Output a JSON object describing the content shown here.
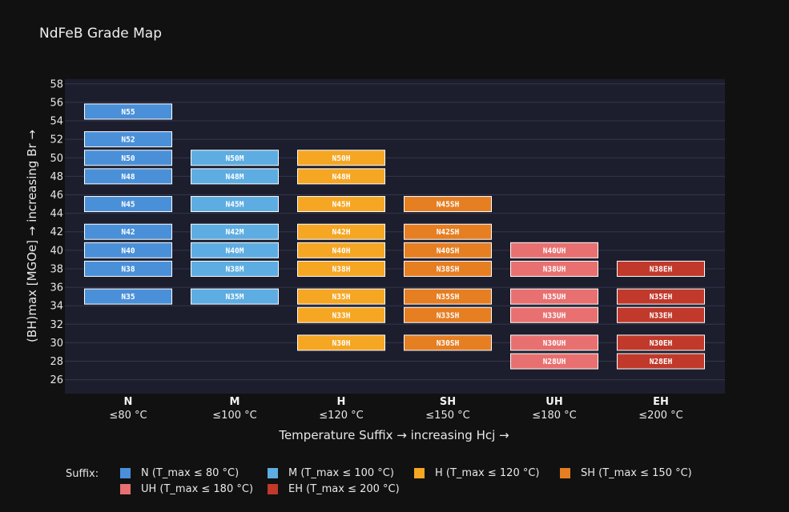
{
  "chart_data": {
    "type": "heatmap",
    "title": "NdFeB Grade Map",
    "xlabel": "Temperature Suffix  →  increasing Hcj  →",
    "ylabel": "(BH)max  [MGOe]  →  increasing Br  →",
    "ylim": [
      24.5,
      58.5
    ],
    "yticks": [
      26,
      28,
      30,
      32,
      34,
      36,
      38,
      40,
      42,
      44,
      46,
      48,
      50,
      52,
      54,
      56,
      58
    ],
    "grid": true,
    "categories": [
      {
        "code": "N",
        "temp": "≤80 °C"
      },
      {
        "code": "M",
        "temp": "≤100 °C"
      },
      {
        "code": "H",
        "temp": "≤120 °C"
      },
      {
        "code": "SH",
        "temp": "≤150 °C"
      },
      {
        "code": "UH",
        "temp": "≤180 °C"
      },
      {
        "code": "EH",
        "temp": "≤200 °C"
      }
    ],
    "series": [
      {
        "name": "N  (T_max ≤ 80 °C)",
        "color": "#4a90d9",
        "points": [
          {
            "value": 55,
            "label": "N55"
          },
          {
            "value": 52,
            "label": "N52"
          },
          {
            "value": 50,
            "label": "N50"
          },
          {
            "value": 48,
            "label": "N48"
          },
          {
            "value": 45,
            "label": "N45"
          },
          {
            "value": 42,
            "label": "N42"
          },
          {
            "value": 40,
            "label": "N40"
          },
          {
            "value": 38,
            "label": "N38"
          },
          {
            "value": 35,
            "label": "N35"
          }
        ]
      },
      {
        "name": "M  (T_max ≤ 100 °C)",
        "color": "#5dade2",
        "points": [
          {
            "value": 50,
            "label": "N50M"
          },
          {
            "value": 48,
            "label": "N48M"
          },
          {
            "value": 45,
            "label": "N45M"
          },
          {
            "value": 42,
            "label": "N42M"
          },
          {
            "value": 40,
            "label": "N40M"
          },
          {
            "value": 38,
            "label": "N38M"
          },
          {
            "value": 35,
            "label": "N35M"
          }
        ]
      },
      {
        "name": "H  (T_max ≤ 120 °C)",
        "color": "#f5a623",
        "points": [
          {
            "value": 50,
            "label": "N50H"
          },
          {
            "value": 48,
            "label": "N48H"
          },
          {
            "value": 45,
            "label": "N45H"
          },
          {
            "value": 42,
            "label": "N42H"
          },
          {
            "value": 40,
            "label": "N40H"
          },
          {
            "value": 38,
            "label": "N38H"
          },
          {
            "value": 35,
            "label": "N35H"
          },
          {
            "value": 33,
            "label": "N33H"
          },
          {
            "value": 30,
            "label": "N30H"
          }
        ]
      },
      {
        "name": "SH  (T_max ≤ 150 °C)",
        "color": "#e67e22",
        "points": [
          {
            "value": 45,
            "label": "N45SH"
          },
          {
            "value": 42,
            "label": "N42SH"
          },
          {
            "value": 40,
            "label": "N40SH"
          },
          {
            "value": 38,
            "label": "N38SH"
          },
          {
            "value": 35,
            "label": "N35SH"
          },
          {
            "value": 33,
            "label": "N33SH"
          },
          {
            "value": 30,
            "label": "N30SH"
          }
        ]
      },
      {
        "name": "UH  (T_max ≤ 180 °C)",
        "color": "#e87070",
        "points": [
          {
            "value": 40,
            "label": "N40UH"
          },
          {
            "value": 38,
            "label": "N38UH"
          },
          {
            "value": 35,
            "label": "N35UH"
          },
          {
            "value": 33,
            "label": "N33UH"
          },
          {
            "value": 30,
            "label": "N30UH"
          },
          {
            "value": 28,
            "label": "N28UH"
          }
        ]
      },
      {
        "name": "EH  (T_max ≤ 200 °C)",
        "color": "#c0392b",
        "points": [
          {
            "value": 38,
            "label": "N38EH"
          },
          {
            "value": 35,
            "label": "N35EH"
          },
          {
            "value": 33,
            "label": "N33EH"
          },
          {
            "value": 30,
            "label": "N30EH"
          },
          {
            "value": 28,
            "label": "N28EH"
          }
        ]
      }
    ],
    "legend": {
      "title": "Suffix:",
      "placement": "bottom"
    },
    "colors": {
      "page_bg": "#111111",
      "plot_bg": "#1c1e2e",
      "grid": "#34374a"
    }
  }
}
